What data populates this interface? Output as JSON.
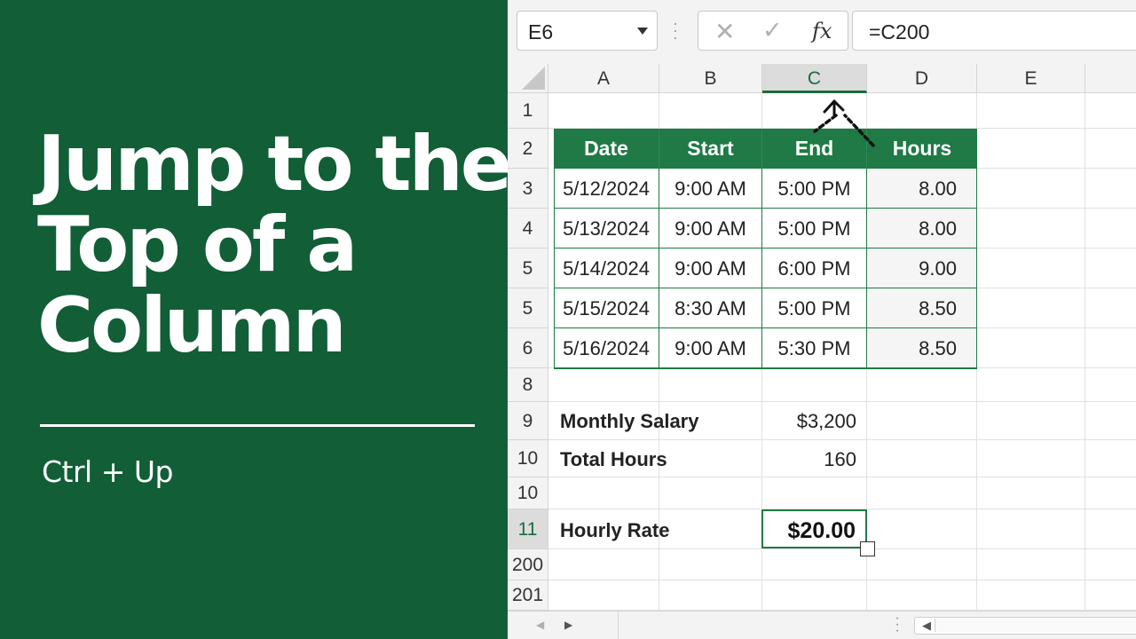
{
  "title": {
    "lines": [
      "Jump to the",
      "Top of a",
      "Column"
    ],
    "shortcut": "Ctrl + Up"
  },
  "formula_bar": {
    "name_box": "E6",
    "cancel_icon": "close-icon",
    "enter_icon": "checkmark-icon",
    "function_label": "fx",
    "formula": "=C200"
  },
  "columns": [
    "A",
    "B",
    "C",
    "D",
    "E"
  ],
  "selected_column": "C",
  "rows": [
    "1",
    "2",
    "3",
    "4",
    "5",
    "5",
    "6",
    "8",
    "9",
    "10",
    "10",
    "11",
    "200",
    "201"
  ],
  "selected_row": "11",
  "table": {
    "headers": [
      "Date",
      "Start",
      "End",
      "Hours"
    ],
    "rows": [
      [
        "5/12/2024",
        "9:00 AM",
        "5:00 PM",
        "8.00"
      ],
      [
        "5/13/2024",
        "9:00 AM",
        "5:00 PM",
        "8.00"
      ],
      [
        "5/14/2024",
        "9:00 AM",
        "6:00 PM",
        "9.00"
      ],
      [
        "5/15/2024",
        "8:30 AM",
        "5:00 PM",
        "8.50"
      ],
      [
        "5/16/2024",
        "9:00 AM",
        "5:30 PM",
        "8.50"
      ]
    ]
  },
  "summary": {
    "salary_label": "Monthly Salary",
    "salary_value": "$3,200",
    "hours_label": "Total Hours",
    "hours_value": "160",
    "rate_label": "Hourly Rate",
    "rate_value": "$20.00"
  },
  "colors": {
    "panel_green": "#115e37",
    "header_green": "#1f7a45",
    "accent_green": "#1a6b3c"
  }
}
